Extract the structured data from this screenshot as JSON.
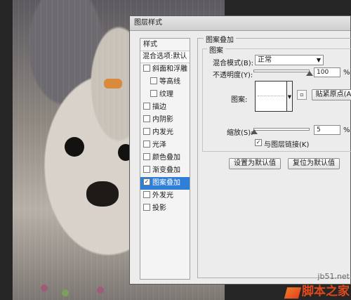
{
  "dialog": {
    "title": "图层样式"
  },
  "left_panel": {
    "header": "样式",
    "blend_options": "混合选项:默认",
    "items": [
      {
        "label": "斜面和浮雕",
        "checked": false,
        "sub": false,
        "active": false
      },
      {
        "label": "等高线",
        "checked": false,
        "sub": true,
        "active": false
      },
      {
        "label": "纹理",
        "checked": false,
        "sub": true,
        "active": false
      },
      {
        "label": "描边",
        "checked": false,
        "sub": false,
        "active": false
      },
      {
        "label": "内阴影",
        "checked": false,
        "sub": false,
        "active": false
      },
      {
        "label": "内发光",
        "checked": false,
        "sub": false,
        "active": false
      },
      {
        "label": "光泽",
        "checked": false,
        "sub": false,
        "active": false
      },
      {
        "label": "颜色叠加",
        "checked": false,
        "sub": false,
        "active": false
      },
      {
        "label": "渐变叠加",
        "checked": false,
        "sub": false,
        "active": false
      },
      {
        "label": "图案叠加",
        "checked": true,
        "sub": false,
        "active": true
      },
      {
        "label": "外发光",
        "checked": false,
        "sub": false,
        "active": false
      },
      {
        "label": "投影",
        "checked": false,
        "sub": false,
        "active": false
      }
    ]
  },
  "pattern_overlay": {
    "section_title": "图案叠加",
    "group_title": "图案",
    "blend_mode_label": "混合模式(B):",
    "blend_mode_value": "正常",
    "opacity_label": "不透明度(Y):",
    "opacity_value": "100",
    "opacity_unit": "%",
    "opacity_level": 1.0,
    "pattern_label": "图案:",
    "snap_origin_button": "贴紧原点(A",
    "scale_label": "缩放(S):",
    "scale_value": "5",
    "scale_unit": "%",
    "scale_level": 0.01,
    "link_label": "与图层链接(K)",
    "link_checked": true,
    "make_default_button": "设置为默认值",
    "reset_default_button": "复位为默认值"
  },
  "watermark": {
    "url": "jb51.net",
    "name": "脚本之家"
  },
  "colors": {
    "active_item": "#2f7fd6",
    "watermark": "#e04a1a"
  }
}
